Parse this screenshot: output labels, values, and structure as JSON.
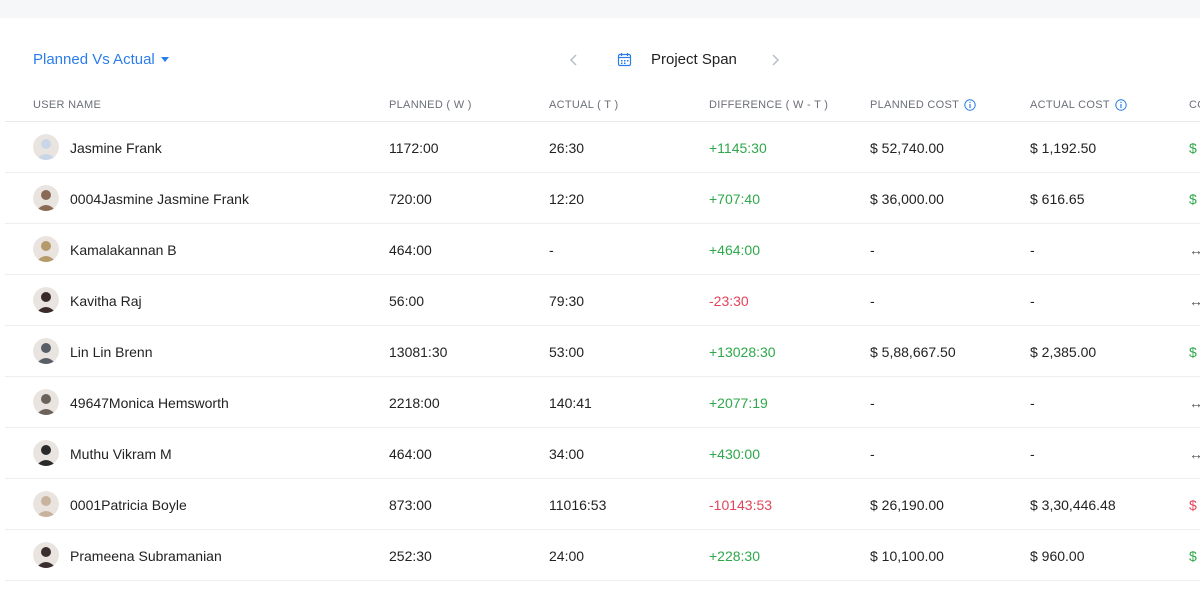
{
  "header": {
    "view_selector": "Planned Vs Actual",
    "span_label": "Project Span"
  },
  "table": {
    "columns": {
      "user_name": "USER NAME",
      "planned": "PLANNED ( W )",
      "actual": "ACTUAL ( T )",
      "difference": "DIFFERENCE ( W - T )",
      "planned_cost": "PLANNED COST",
      "actual_cost": "ACTUAL COST",
      "cost_diff": "CO"
    },
    "rows": [
      {
        "name": "Jasmine Frank",
        "planned": "1172:00",
        "actual": "26:30",
        "difference": "+1145:30",
        "planned_cost": "$ 52,740.00",
        "actual_cost": "$ 1,192.50",
        "extra": "$",
        "avatar_color": "#c9d6e8"
      },
      {
        "name": "0004Jasmine Jasmine Frank",
        "planned": "720:00",
        "actual": "12:20",
        "difference": "+707:40",
        "planned_cost": "$ 36,000.00",
        "actual_cost": "$ 616.65",
        "extra": "$",
        "avatar_color": "#8a6a55"
      },
      {
        "name": "Kamalakannan B",
        "planned": "464:00",
        "actual": "-",
        "difference": "+464:00",
        "planned_cost": "-",
        "actual_cost": "-",
        "extra": "↔",
        "avatar_color": "#b59a6c"
      },
      {
        "name": "Kavitha Raj",
        "planned": "56:00",
        "actual": "79:30",
        "difference": "-23:30",
        "planned_cost": "-",
        "actual_cost": "-",
        "extra": "↔",
        "avatar_color": "#3a2a2a"
      },
      {
        "name": "Lin Lin Brenn",
        "planned": "13081:30",
        "actual": "53:00",
        "difference": "+13028:30",
        "planned_cost": "$ 5,88,667.50",
        "actual_cost": "$ 2,385.00",
        "extra": "$",
        "avatar_color": "#5a5e66"
      },
      {
        "name": "49647Monica Hemsworth",
        "planned": "2218:00",
        "actual": "140:41",
        "difference": "+2077:19",
        "planned_cost": "-",
        "actual_cost": "-",
        "extra": "↔",
        "avatar_color": "#6b625c"
      },
      {
        "name": "Muthu Vikram M",
        "planned": "464:00",
        "actual": "34:00",
        "difference": "+430:00",
        "planned_cost": "-",
        "actual_cost": "-",
        "extra": "↔",
        "avatar_color": "#2a2a2a"
      },
      {
        "name": "0001Patricia Boyle",
        "planned": "873:00",
        "actual": "11016:53",
        "difference": "-10143:53",
        "planned_cost": "$ 26,190.00",
        "actual_cost": "$ 3,30,446.48",
        "extra": "$",
        "avatar_color": "#c8b49e"
      },
      {
        "name": "Prameena Subramanian",
        "planned": "252:30",
        "actual": "24:00",
        "difference": "+228:30",
        "planned_cost": "$ 10,100.00",
        "actual_cost": "$ 960.00",
        "extra": "$",
        "avatar_color": "#3b2e2e"
      }
    ]
  },
  "icons": {
    "prev": "chevron-left-icon",
    "next": "chevron-right-icon",
    "calendar": "calendar-icon",
    "info": "info-icon",
    "dropdown": "caret-down-icon"
  },
  "colors": {
    "accent": "#2b7de9",
    "positive": "#2ea84a",
    "negative": "#e2445c"
  }
}
